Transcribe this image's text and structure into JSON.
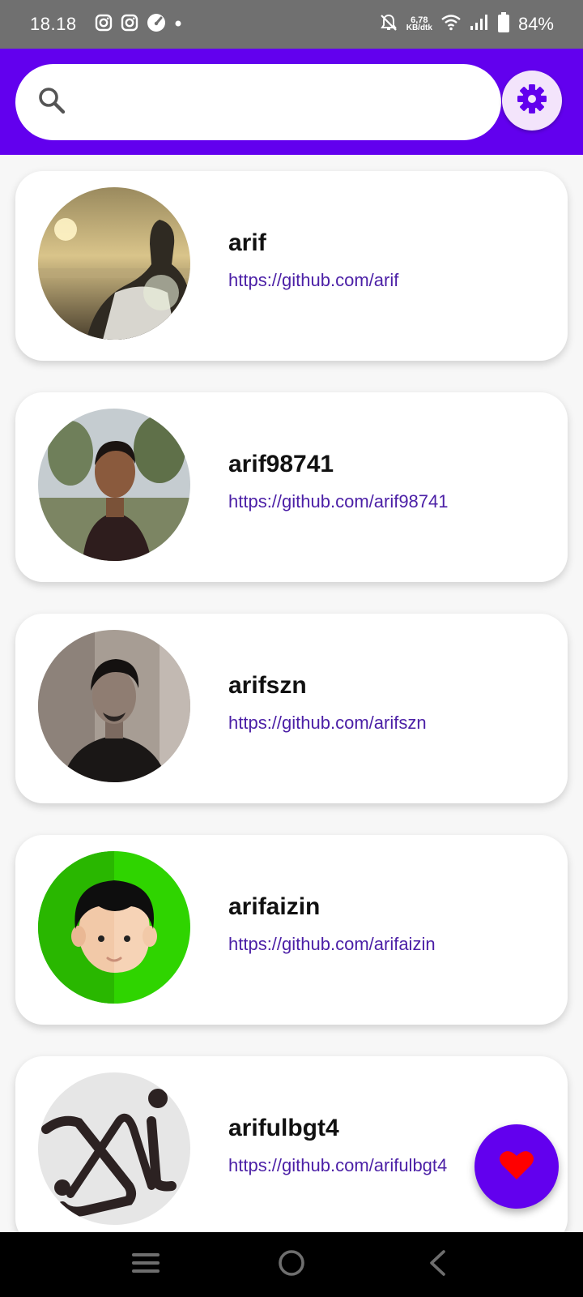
{
  "status_bar": {
    "time": "18.18",
    "net_speed_value": "6,78",
    "net_speed_unit": "KB/dtk",
    "battery": "84%",
    "left_icons": [
      "instagram-icon",
      "instagram-icon",
      "speedometer-icon",
      "dot-icon"
    ],
    "right_icons": [
      "notifications-off-icon",
      "wifi-icon",
      "signal-icon",
      "battery-icon"
    ]
  },
  "search": {
    "value": "",
    "placeholder": "",
    "icon": "search-icon"
  },
  "settings": {
    "icon": "gear-icon"
  },
  "users": [
    {
      "login": "arif",
      "url": "https://github.com/arif"
    },
    {
      "login": "arif98741",
      "url": "https://github.com/arif98741"
    },
    {
      "login": "arifszn",
      "url": "https://github.com/arifszn"
    },
    {
      "login": "arifaizin",
      "url": "https://github.com/arifaizin"
    },
    {
      "login": "arifulbgt4",
      "url": "https://github.com/arifulbgt4"
    }
  ],
  "fab": {
    "icon": "heart-icon"
  },
  "nav": {
    "icons": [
      "menu-icon",
      "home-circle-icon",
      "back-icon"
    ]
  },
  "colors": {
    "primary": "#6200ee",
    "status_bar": "#707070",
    "link": "#4b1fa6",
    "settings_bg": "#f3e4fb",
    "heart": "#ff0000"
  }
}
